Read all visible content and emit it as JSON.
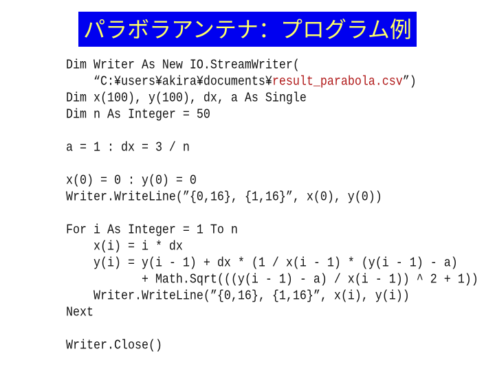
{
  "title": "パラボラアンテナ：プログラム例",
  "colors": {
    "title_background": "#0000f0",
    "title_text": "#ffff66",
    "code_text": "#111111",
    "string_highlight": "#b01818"
  },
  "code": {
    "lines": [
      {
        "text": "Dim Writer As New IO.StreamWriter("
      },
      {
        "pre": "    “C:¥users¥akira¥documents¥",
        "highlight": "result_parabola.csv",
        "post": "”)"
      },
      {
        "text": "Dim x(100), y(100), dx, a As Single"
      },
      {
        "text": "Dim n As Integer = 50"
      },
      {
        "text": ""
      },
      {
        "text": "a = 1 : dx = 3 / n"
      },
      {
        "text": ""
      },
      {
        "text": "x(0) = 0 : y(0) = 0"
      },
      {
        "text": "Writer.WriteLine(”{0,16}, {1,16}”, x(0), y(0))"
      },
      {
        "text": ""
      },
      {
        "text": "For i As Integer = 1 To n"
      },
      {
        "text": "    x(i) = i * dx"
      },
      {
        "text": "    y(i) = y(i - 1) + dx * (1 / x(i - 1) * (y(i - 1) - a)"
      },
      {
        "text": "           + Math.Sqrt(((y(i - 1) - a) / x(i - 1)) ^ 2 + 1))"
      },
      {
        "text": "    Writer.WriteLine(”{0,16}, {1,16}”, x(i), y(i))"
      },
      {
        "text": "Next"
      },
      {
        "text": ""
      },
      {
        "text": "Writer.Close()"
      }
    ]
  }
}
